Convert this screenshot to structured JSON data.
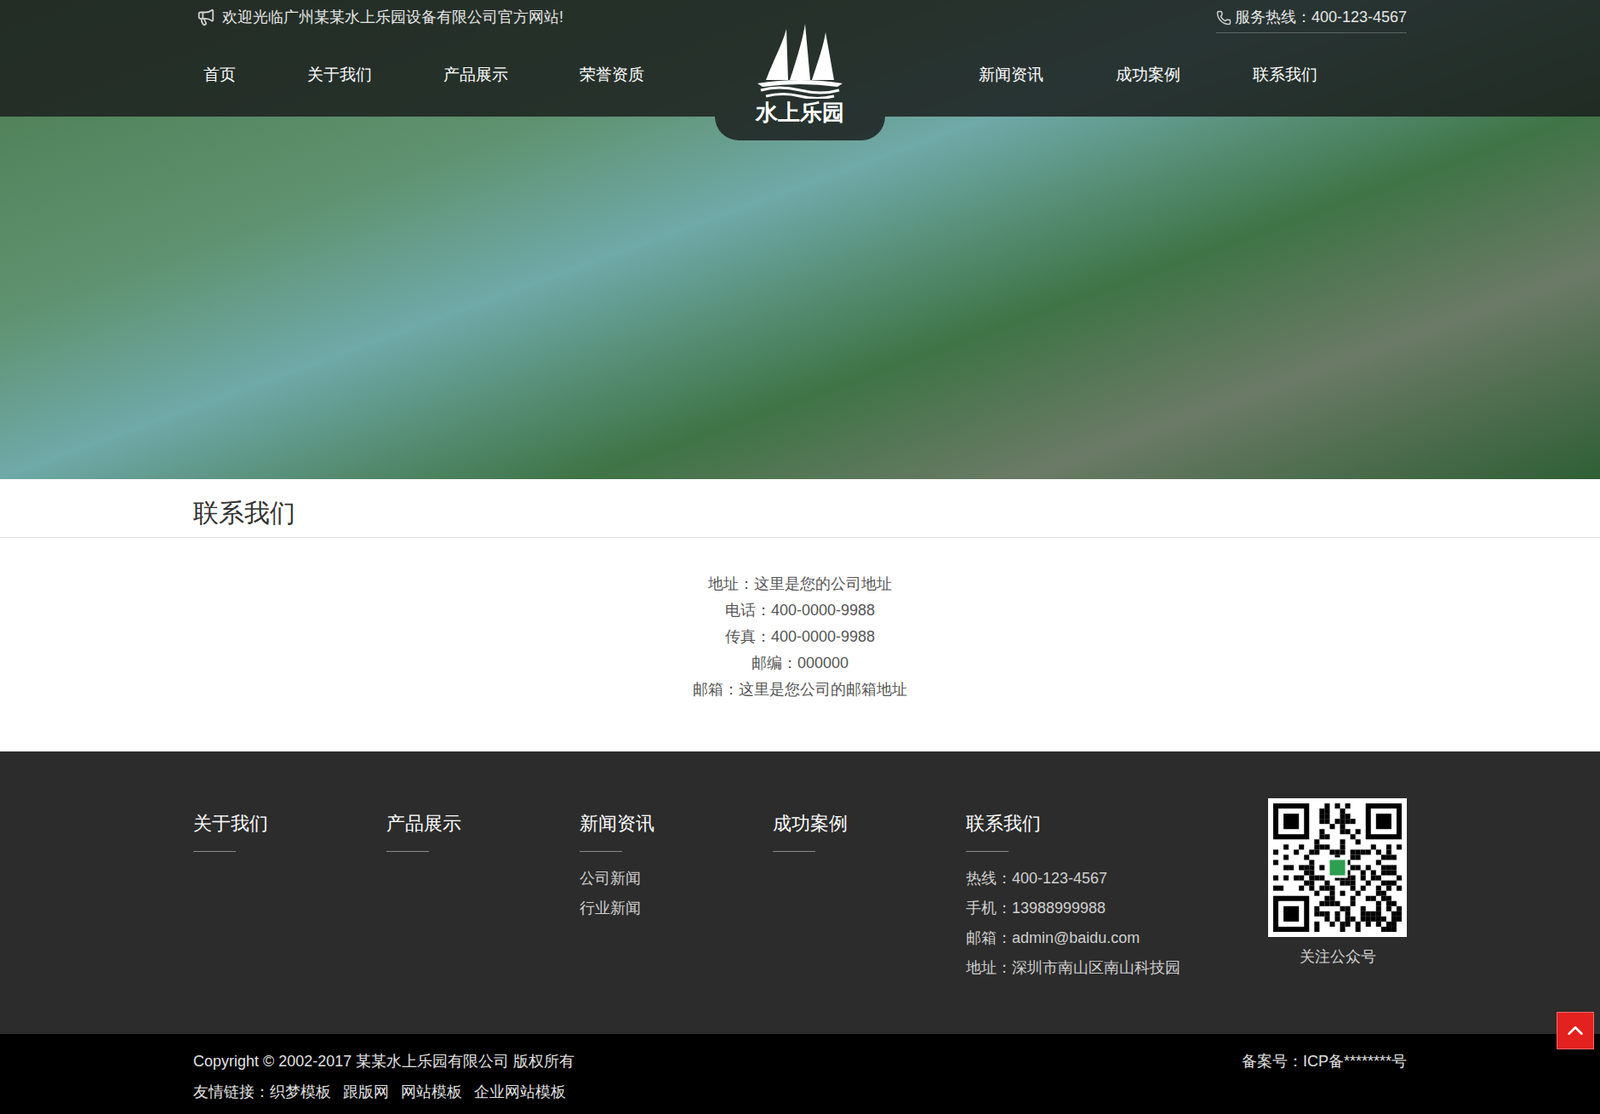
{
  "top_bar": {
    "welcome": "欢迎光临广州某某水上乐园设备有限公司官方网站!",
    "hotline": "服务热线：400-123-4567"
  },
  "nav": {
    "left": [
      "首页",
      "关于我们",
      "产品展示",
      "荣誉资质"
    ],
    "right": [
      "新闻资讯",
      "成功案例",
      "联系我们"
    ]
  },
  "logo": {
    "text": "水上乐园"
  },
  "page": {
    "title": "联系我们",
    "contact_lines": [
      "地址：这里是您的公司地址",
      "电话：400-0000-9988",
      "传真：400-0000-9988",
      "邮编：000000",
      "邮箱：这里是您公司的邮箱地址"
    ]
  },
  "footer": {
    "columns": [
      {
        "title": "关于我们",
        "links": []
      },
      {
        "title": "产品展示",
        "links": []
      },
      {
        "title": "新闻资讯",
        "links": [
          "公司新闻",
          "行业新闻"
        ]
      },
      {
        "title": "成功案例",
        "links": []
      },
      {
        "title": "联系我们",
        "links": [
          "热线：400-123-4567",
          "手机：13988999988",
          "邮箱：admin@baidu.com",
          "地址：深圳市南山区南山科技园"
        ]
      }
    ],
    "qr": {
      "label": "关注公众号"
    }
  },
  "bottom_bar": {
    "copyright": "Copyright © 2002-2017 某某水上乐园有限公司 版权所有",
    "friend_links_label": "友情链接：",
    "friend_links": [
      "织梦模板",
      "跟版网",
      "网站模板",
      "企业网站模板"
    ],
    "icp": "备案号：ICP备********号"
  }
}
